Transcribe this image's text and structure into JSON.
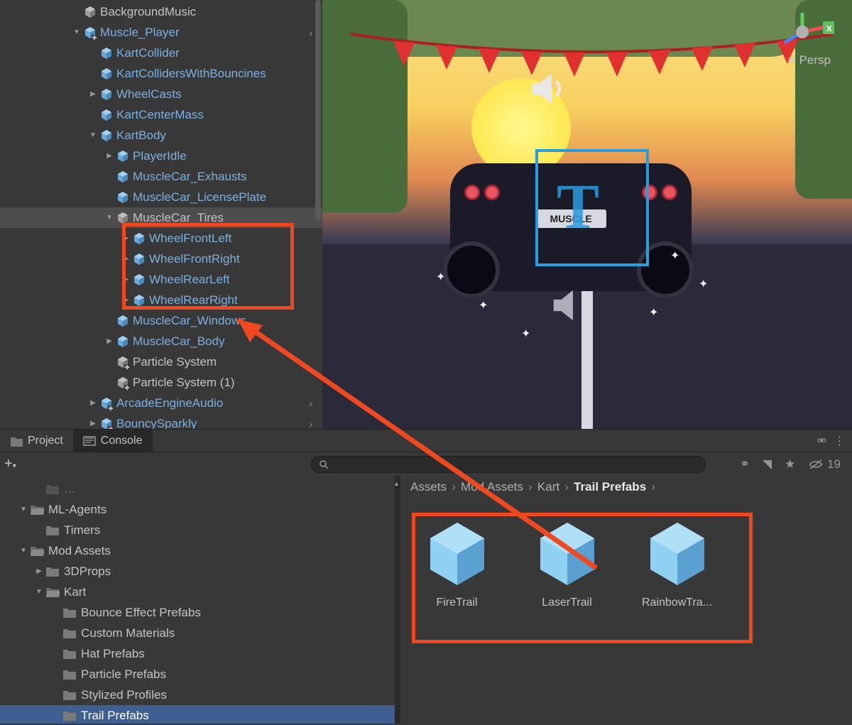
{
  "hierarchy": {
    "items": [
      {
        "label": "BackgroundMusic",
        "indent": 2,
        "prefab": false,
        "foldout": "",
        "chevron": false,
        "variant": false
      },
      {
        "label": "Muscle_Player",
        "indent": 2,
        "prefab": true,
        "foldout": "expanded",
        "chevron": true,
        "variant": false
      },
      {
        "label": "KartCollider",
        "indent": 3,
        "prefab": true,
        "foldout": "",
        "chevron": false,
        "variant": false
      },
      {
        "label": "KartCollidersWithBouncines",
        "indent": 3,
        "prefab": true,
        "foldout": "",
        "chevron": false,
        "variant": false
      },
      {
        "label": "WheelCasts",
        "indent": 3,
        "prefab": true,
        "foldout": "collapsed",
        "chevron": false,
        "variant": false
      },
      {
        "label": "KartCenterMass",
        "indent": 3,
        "prefab": true,
        "foldout": "",
        "chevron": false,
        "variant": false
      },
      {
        "label": "KartBody",
        "indent": 3,
        "prefab": true,
        "foldout": "expanded",
        "chevron": false,
        "variant": false
      },
      {
        "label": "PlayerIdle",
        "indent": 4,
        "prefab": true,
        "foldout": "collapsed",
        "chevron": false,
        "variant": false
      },
      {
        "label": "MuscleCar_Exhausts",
        "indent": 4,
        "prefab": true,
        "foldout": "",
        "chevron": false,
        "variant": false
      },
      {
        "label": "MuscleCar_LicensePlate",
        "indent": 4,
        "prefab": true,
        "foldout": "",
        "chevron": false,
        "variant": false
      },
      {
        "label": "MuscleCar_Tires",
        "indent": 4,
        "prefab": false,
        "foldout": "expanded",
        "chevron": false,
        "variant": false
      },
      {
        "label": "WheelFrontLeft",
        "indent": 5,
        "prefab": true,
        "foldout": "collapsed",
        "chevron": false,
        "variant": false
      },
      {
        "label": "WheelFrontRight",
        "indent": 5,
        "prefab": true,
        "foldout": "collapsed",
        "chevron": false,
        "variant": false
      },
      {
        "label": "WheelRearLeft",
        "indent": 5,
        "prefab": true,
        "foldout": "collapsed",
        "chevron": false,
        "variant": false
      },
      {
        "label": "WheelRearRight",
        "indent": 5,
        "prefab": true,
        "foldout": "collapsed",
        "chevron": false,
        "variant": false
      },
      {
        "label": "MuscleCar_Windows",
        "indent": 4,
        "prefab": true,
        "foldout": "",
        "chevron": false,
        "variant": false
      },
      {
        "label": "MuscleCar_Body",
        "indent": 4,
        "prefab": true,
        "foldout": "collapsed",
        "chevron": false,
        "variant": false
      },
      {
        "label": "Particle System",
        "indent": 4,
        "prefab": false,
        "foldout": "",
        "chevron": false,
        "variant": true
      },
      {
        "label": "Particle System (1)",
        "indent": 4,
        "prefab": false,
        "foldout": "",
        "chevron": false,
        "variant": true
      },
      {
        "label": "ArcadeEngineAudio",
        "indent": 3,
        "prefab": true,
        "foldout": "collapsed",
        "chevron": true,
        "variant": false
      },
      {
        "label": "BouncySparkly",
        "indent": 3,
        "prefab": true,
        "foldout": "collapsed",
        "chevron": true,
        "variant": false
      }
    ]
  },
  "scene": {
    "persp_label": "Persp",
    "license_plate": "MUSCLE",
    "x_axis": "x"
  },
  "tabs": {
    "project": "Project",
    "console": "Console"
  },
  "toolbar": {
    "hidden_count": "19"
  },
  "folders": {
    "items": [
      {
        "label": "ML-Agents",
        "indent": 1,
        "foldout": "expanded"
      },
      {
        "label": "Timers",
        "indent": 2,
        "foldout": ""
      },
      {
        "label": "Mod Assets",
        "indent": 1,
        "foldout": "expanded"
      },
      {
        "label": "3DProps",
        "indent": 2,
        "foldout": "collapsed"
      },
      {
        "label": "Kart",
        "indent": 2,
        "foldout": "expanded"
      },
      {
        "label": "Bounce Effect Prefabs",
        "indent": 3,
        "foldout": ""
      },
      {
        "label": "Custom Materials",
        "indent": 3,
        "foldout": ""
      },
      {
        "label": "Hat Prefabs",
        "indent": 3,
        "foldout": ""
      },
      {
        "label": "Particle Prefabs",
        "indent": 3,
        "foldout": ""
      },
      {
        "label": "Stylized Profiles",
        "indent": 3,
        "foldout": ""
      },
      {
        "label": "Trail Prefabs",
        "indent": 3,
        "foldout": "",
        "selected": true
      }
    ]
  },
  "breadcrumb": {
    "parts": [
      "Assets",
      "Mod Assets",
      "Kart",
      "Trail Prefabs"
    ],
    "active_index": 3
  },
  "assets": {
    "items": [
      {
        "label": "FireTrail"
      },
      {
        "label": "LaserTrail"
      },
      {
        "label": "RainbowTra..."
      }
    ]
  },
  "search": {
    "placeholder": ""
  }
}
